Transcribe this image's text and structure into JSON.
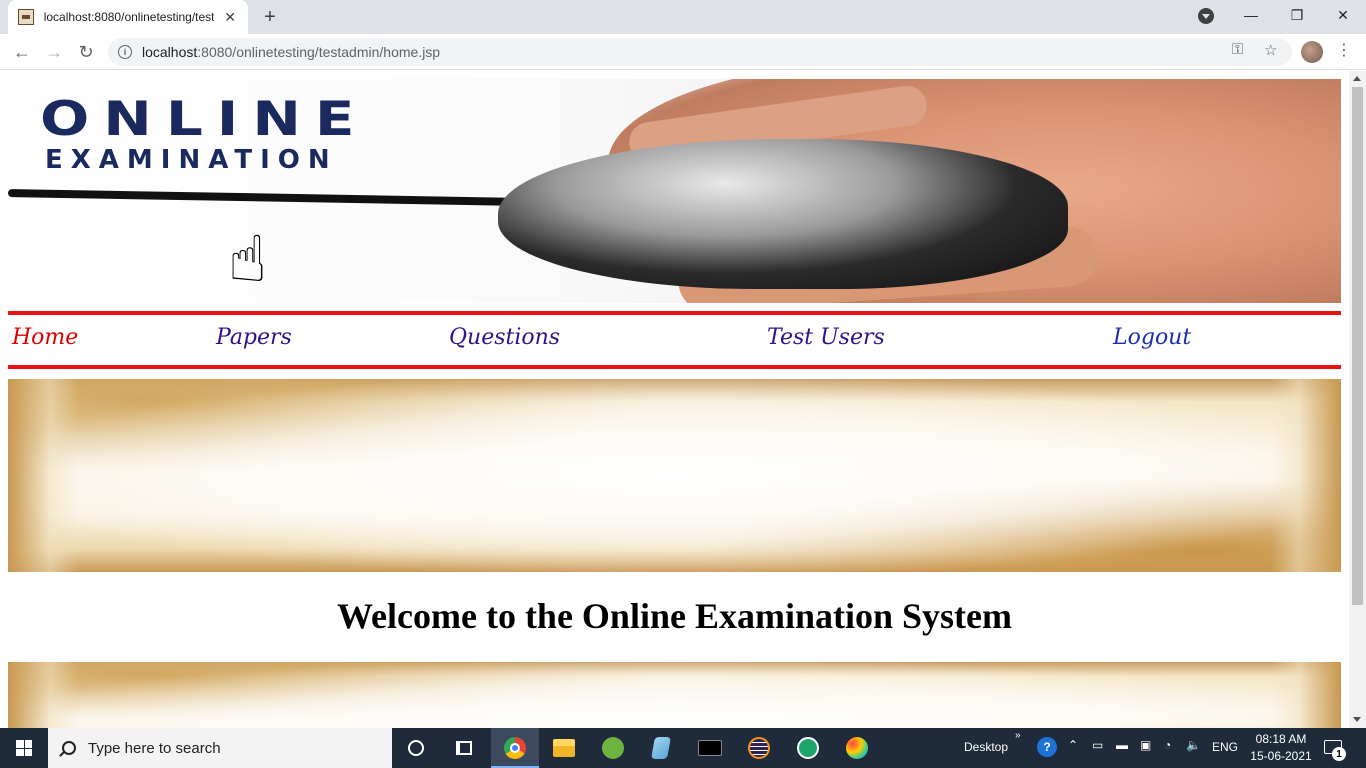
{
  "browser": {
    "tab_title": "localhost:8080/onlinetesting/test",
    "tab_close": "✕",
    "new_tab": "+",
    "url_host": "localhost",
    "url_rest": ":8080/onlinetesting/testadmin/home.jsp",
    "nav": {
      "back": "←",
      "forward": "→",
      "reload": "↻"
    },
    "window": {
      "minimize": "—",
      "restore": "❐",
      "close": "✕"
    }
  },
  "page": {
    "banner": {
      "line1": "ONLINE",
      "line2": "EXAMINATION"
    },
    "nav": {
      "home": "Home",
      "papers": "Papers",
      "questions": "Questions",
      "test_users": "Test Users",
      "logout": "Logout"
    },
    "welcome": "Welcome to the Online Examination System",
    "colors": {
      "rule": "#ee1111",
      "home_link": "#dd0000",
      "nav_link": "#331188",
      "logout_link": "#1a2fb0"
    }
  },
  "taskbar": {
    "search_placeholder": "Type here to search",
    "desktop_label": "Desktop",
    "language": "ENG",
    "time": "08:18 AM",
    "date": "15-06-2021",
    "notification_count": "1",
    "apps": [
      "task-view",
      "chrome",
      "file-explorer",
      "spring-tool-suite",
      "notepad",
      "mysql",
      "eclipse",
      "app-check",
      "paint"
    ]
  }
}
